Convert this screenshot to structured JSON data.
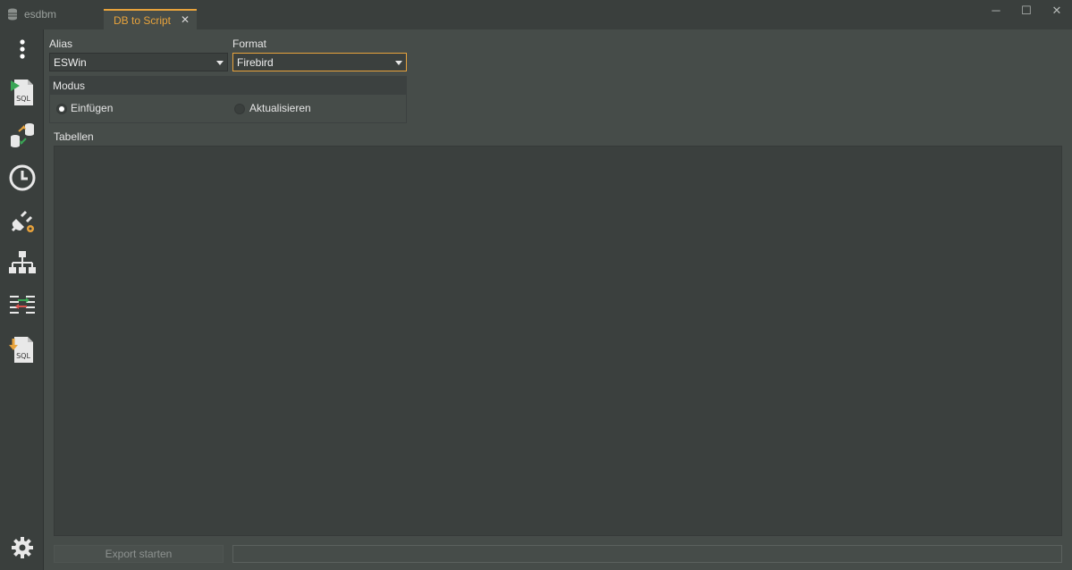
{
  "window": {
    "app_title": "esdbm",
    "tab_label": "DB to Script",
    "tab_close": "✕",
    "minimize": "─",
    "maximize": "☐",
    "close": "✕"
  },
  "sidebar": {
    "items": [
      {
        "name": "menu-icon"
      },
      {
        "name": "sql-run-icon",
        "text": "SQL"
      },
      {
        "name": "db-transfer-icon"
      },
      {
        "name": "clock-icon"
      },
      {
        "name": "plug-settings-icon"
      },
      {
        "name": "hierarchy-icon"
      },
      {
        "name": "compare-icon"
      },
      {
        "name": "sql-export-icon",
        "text": "SQL"
      },
      {
        "name": "gear-icon"
      }
    ]
  },
  "form": {
    "alias_label": "Alias",
    "alias_value": "ESWin",
    "format_label": "Format",
    "format_value": "Firebird",
    "modus_label": "Modus",
    "modus_options": [
      "Einfügen",
      "Aktualisieren"
    ],
    "modus_selected": "Einfügen",
    "tables_label": "Tabellen",
    "tables": [],
    "export_button": "Export starten",
    "progress": 0
  },
  "colors": {
    "accent": "#e8a33c",
    "background": "#464c49",
    "panel": "#3b403e",
    "sidebar": "#3a3f3d"
  }
}
